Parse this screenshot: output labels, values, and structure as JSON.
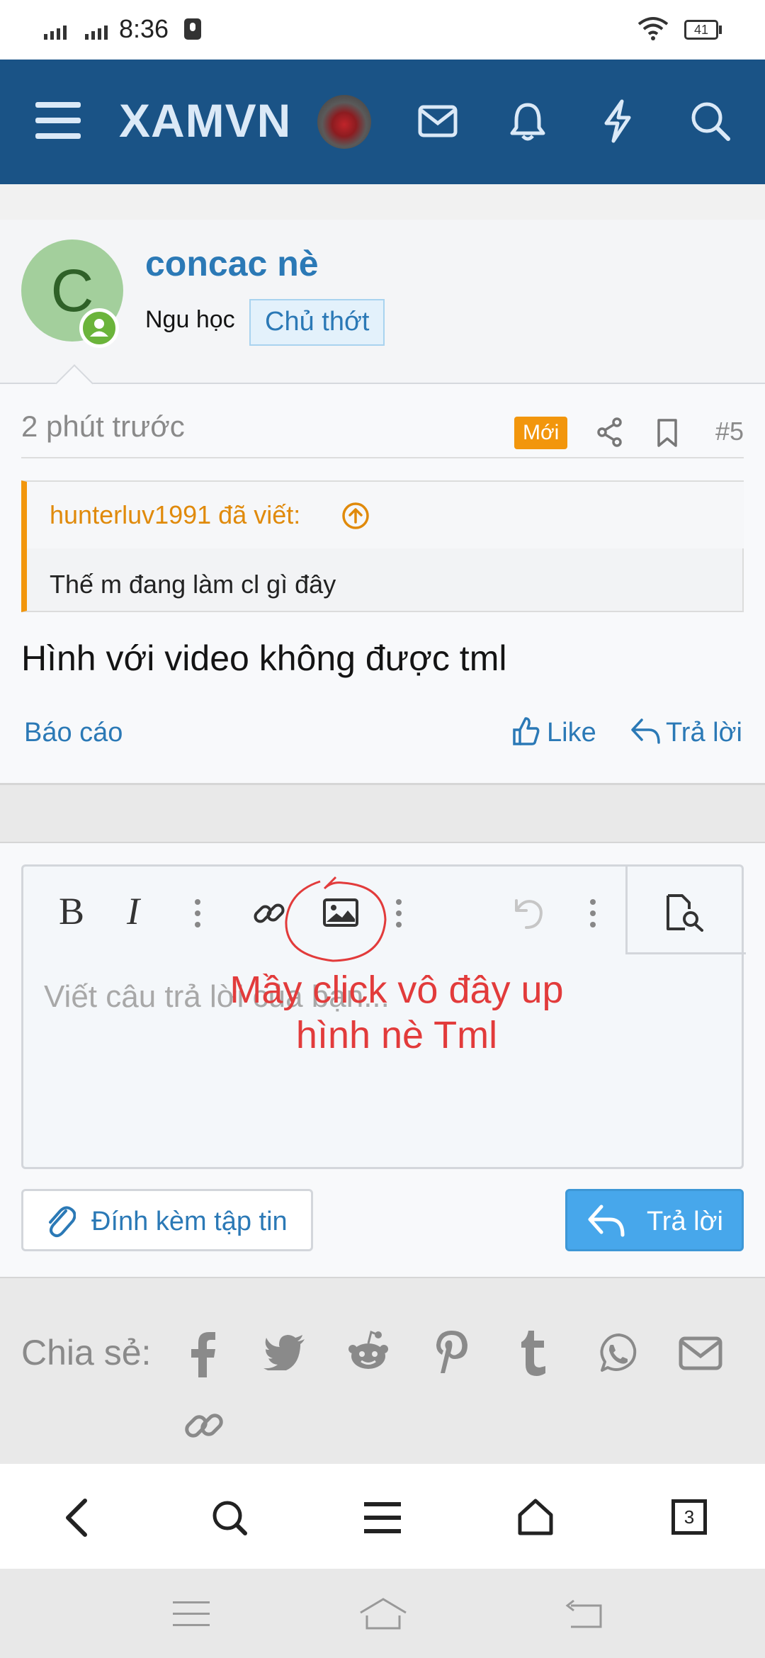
{
  "status_bar": {
    "time": "8:36",
    "battery": "41"
  },
  "header": {
    "logo": "XAMVN"
  },
  "post": {
    "author_initial": "C",
    "username": "concac nè",
    "user_title": "Ngu học",
    "op_badge": "Chủ thớt",
    "time": "2 phút trước",
    "new_badge": "Mới",
    "post_number": "#5",
    "quote": {
      "author": "hunterluv1991 đã viết:",
      "text": "Thế m đang làm cl gì đây"
    },
    "message": "Hình với video không được tml",
    "actions": {
      "report": "Báo cáo",
      "like": "Like",
      "reply": "Trả lời"
    }
  },
  "editor": {
    "placeholder": "Viết câu trả lời của bạn...",
    "annotation_line1": "Mầy click vô đây up",
    "annotation_line2": "hình nè Tml",
    "attach_label": "Đính kèm tập tin",
    "reply_label": "Trả lời"
  },
  "share": {
    "label": "Chia sẻ:"
  },
  "browser": {
    "tab_count": "3"
  },
  "colors": {
    "header": "#1a5386",
    "link": "#2b79b6",
    "accent": "#f2960c",
    "reply_button": "#47a7eb",
    "annotation": "#e23b3b"
  }
}
